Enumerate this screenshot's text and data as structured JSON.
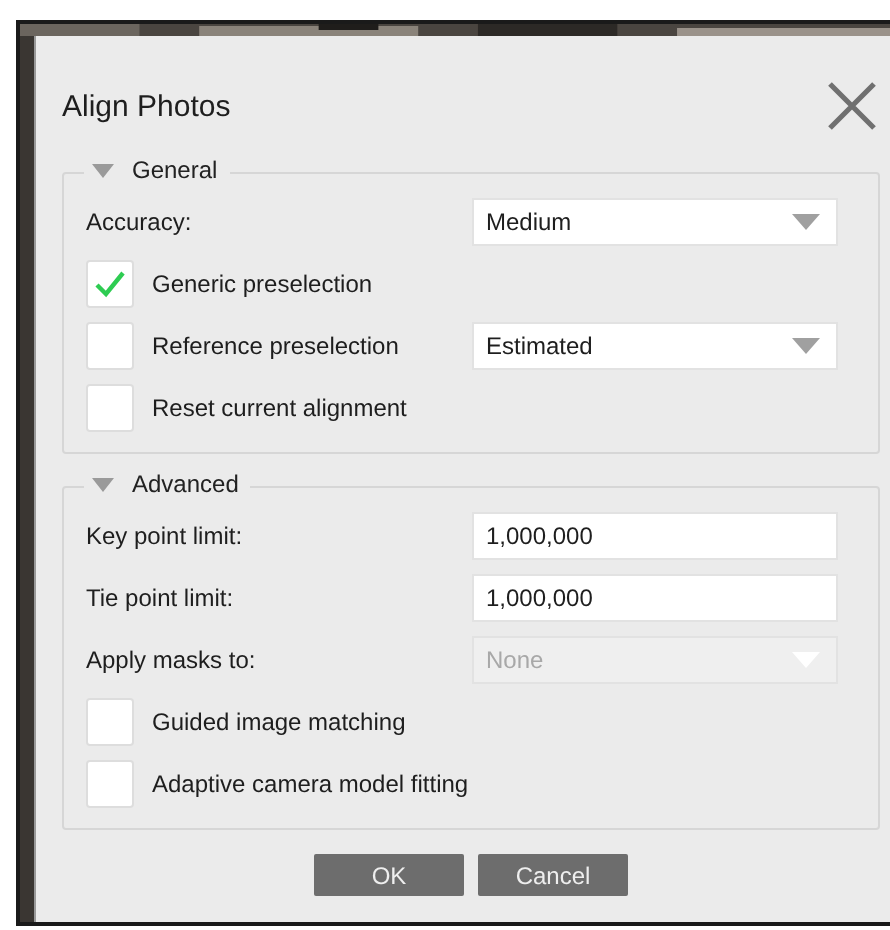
{
  "dialog": {
    "title": "Align Photos"
  },
  "groups": [
    {
      "title": "General",
      "expanded": true,
      "rows": [
        {
          "kind": "dropdown",
          "label": "Accuracy:",
          "value": "Medium",
          "disabled": false
        },
        {
          "kind": "checkbox",
          "label": "Generic preselection",
          "checked": true
        },
        {
          "kind": "checkbox",
          "label": "Reference preselection",
          "checked": false,
          "dropdown": {
            "value": "Estimated",
            "disabled": false
          }
        },
        {
          "kind": "checkbox",
          "label": "Reset current alignment",
          "checked": false
        }
      ]
    },
    {
      "title": "Advanced",
      "expanded": true,
      "rows": [
        {
          "kind": "field",
          "label": "Key point limit:",
          "value": "1,000,000"
        },
        {
          "kind": "field",
          "label": "Tie point limit:",
          "value": "1,000,000"
        },
        {
          "kind": "dropdown",
          "label": "Apply masks to:",
          "value": "None",
          "disabled": true
        },
        {
          "kind": "checkbox",
          "label": "Guided image matching",
          "checked": false
        },
        {
          "kind": "checkbox",
          "label": "Adaptive camera model fitting",
          "checked": false
        }
      ]
    }
  ],
  "buttons": [
    {
      "label": "OK"
    },
    {
      "label": "Cancel"
    }
  ]
}
